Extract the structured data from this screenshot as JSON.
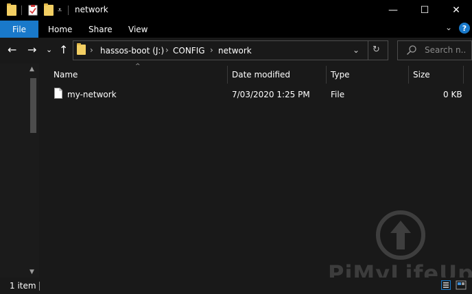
{
  "window": {
    "title": "network",
    "minimize_glyph": "—",
    "maximize_glyph": "☐",
    "close_glyph": "✕"
  },
  "quick_access": {
    "customize_glyph": "⩡"
  },
  "ribbon": {
    "tabs": [
      "File",
      "Home",
      "Share",
      "View"
    ],
    "collapse_glyph": "⌄",
    "help_glyph": "?"
  },
  "nav": {
    "back_glyph": "←",
    "forward_glyph": "→",
    "recent_glyph": "⌄",
    "up_glyph": "↑",
    "breadcrumbs": [
      "hassos-boot (J:)",
      "CONFIG",
      "network"
    ],
    "crumb_sep": "›",
    "dropdown_glyph": "⌄",
    "refresh_glyph": "↻"
  },
  "search": {
    "placeholder": "Search n..."
  },
  "table": {
    "columns": [
      "Name",
      "Date modified",
      "Type",
      "Size"
    ],
    "sort_glyph": "^",
    "rows": [
      {
        "name": "my-network",
        "date": "7/03/2020 1:25 PM",
        "type": "File",
        "size": "0 KB"
      }
    ]
  },
  "scrollbar": {
    "up_glyph": "▲",
    "down_glyph": "▼"
  },
  "status": {
    "item_count": "1 item"
  },
  "watermark": {
    "text": "PiMyLifeUp"
  },
  "colors": {
    "accent": "#1979ca",
    "folder": "#f3cf63",
    "background": "#191919",
    "titlebar": "#000000"
  },
  "icons": [
    "folder-icon",
    "properties-icon",
    "new-folder-icon",
    "help-icon",
    "search-icon",
    "file-icon",
    "refresh-icon",
    "details-view-icon",
    "large-icons-view-icon"
  ]
}
